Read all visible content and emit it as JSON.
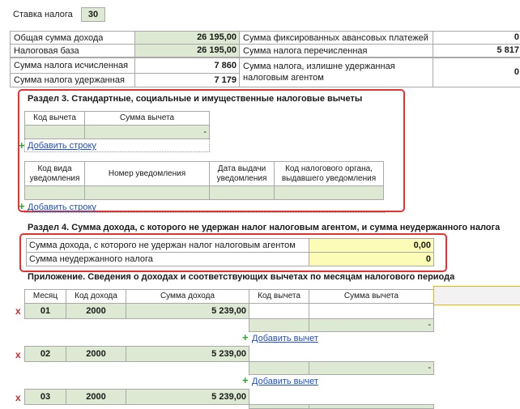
{
  "tax_rate": {
    "label": "Ставка налога",
    "value": "30"
  },
  "summary": {
    "left": [
      {
        "label": "Общая сумма дохода",
        "value": "26 195,00"
      },
      {
        "label": "Налоговая база",
        "value": "26 195,00"
      },
      {
        "label": "Сумма налога исчисленная",
        "value": "7 860"
      },
      {
        "label": "Сумма налога удержанная",
        "value": "7 179"
      }
    ],
    "right": [
      {
        "label": "Сумма фиксированных авансовых платежей",
        "value": "0"
      },
      {
        "label": "Сумма налога перечисленная",
        "value": "5 817"
      },
      {
        "label": "Сумма налога, излишне удержанная налоговым агентом",
        "value": "0"
      }
    ]
  },
  "section3": {
    "title": "Раздел 3. Стандартные, социальные и имущественные налоговые вычеты",
    "table1": {
      "col_code": "Код вычета",
      "col_sum": "Сумма вычета",
      "row_sum": "-"
    },
    "add_row_1": "Добавить строку",
    "table2": {
      "col1": "Код вида уведомления",
      "col2": "Номер уведомления",
      "col3": "Дата выдачи уведомления",
      "col4": "Код налогового органа, выдавшего уведомления"
    },
    "add_row_2": "Добавить строку"
  },
  "section4": {
    "title": "Раздел 4. Сумма дохода, с которого не удержан налог налоговым агентом, и сумма неудержанного налога",
    "rows": [
      {
        "label": "Сумма дохода, с которого не удержан налог налоговым агентом",
        "value": "0,00"
      },
      {
        "label": "Сумма неудержанного налога",
        "value": "0"
      }
    ]
  },
  "appendix": {
    "title": "Приложение. Сведения о доходах и соответствующих вычетах по месяцам налогового периода",
    "headers": {
      "month": "Месяц",
      "income_code": "Код дохода",
      "income_sum": "Сумма дохода",
      "deduction_code": "Код вычета",
      "deduction_sum": "Сумма вычета"
    },
    "rows": [
      {
        "month": "01",
        "code": "2000",
        "sum": "5 239,00",
        "deduction_sum": "-"
      },
      {
        "month": "02",
        "code": "2000",
        "sum": "5 239,00",
        "deduction_sum": "-"
      },
      {
        "month": "03",
        "code": "2000",
        "sum": "5 239,00",
        "deduction_sum": "-"
      }
    ],
    "add_deduction": "Добавить вычет",
    "delete_mark": "x",
    "plus_mark": "+"
  },
  "colors": {
    "green": "#dde9d2",
    "yellow": "#fdfcb7",
    "highlight": "#e03535",
    "link": "#1f4fc4"
  }
}
